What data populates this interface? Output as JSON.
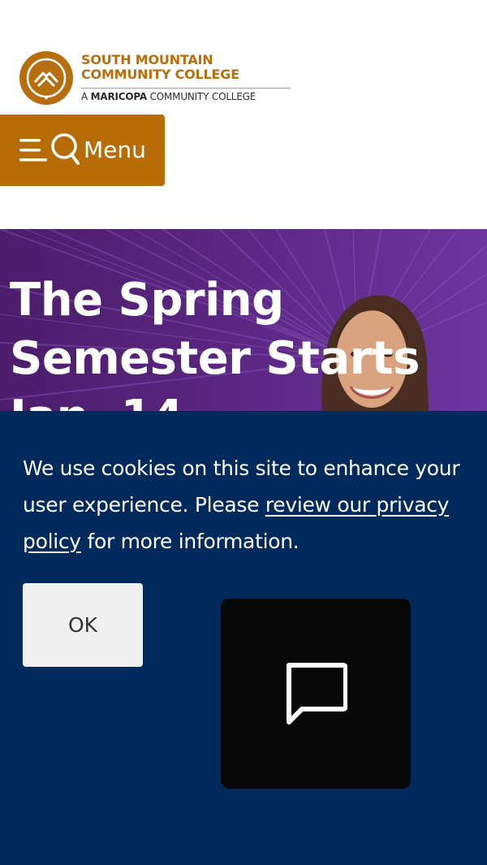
{
  "header": {
    "logo": {
      "line1": "SOUTH MOUNTAIN",
      "line2": "COMMUNITY COLLEGE",
      "line3_prefix": "A",
      "line3_bold": "MARICOPA",
      "line3_suffix": "COMMUNITY COLLEGE",
      "icon": "mountain-logo-icon"
    },
    "menu_button": {
      "label": "Menu",
      "icons": [
        "hamburger-icon",
        "search-icon"
      ]
    }
  },
  "hero": {
    "title": "The Spring Semester Starts Jan. 14"
  },
  "cookie_banner": {
    "text_before_link": "We use cookies on this site to enhance your user experience. Please ",
    "link_text": "review our privacy policy",
    "text_after_link": " for more information.",
    "ok_label": "OK"
  },
  "chat": {
    "icon": "chat-bubble-icon"
  },
  "colors": {
    "brand_orange": "#b86c06",
    "hero_purple": "#5a2680",
    "banner_navy": "#002a5c",
    "chat_black": "#070707"
  }
}
